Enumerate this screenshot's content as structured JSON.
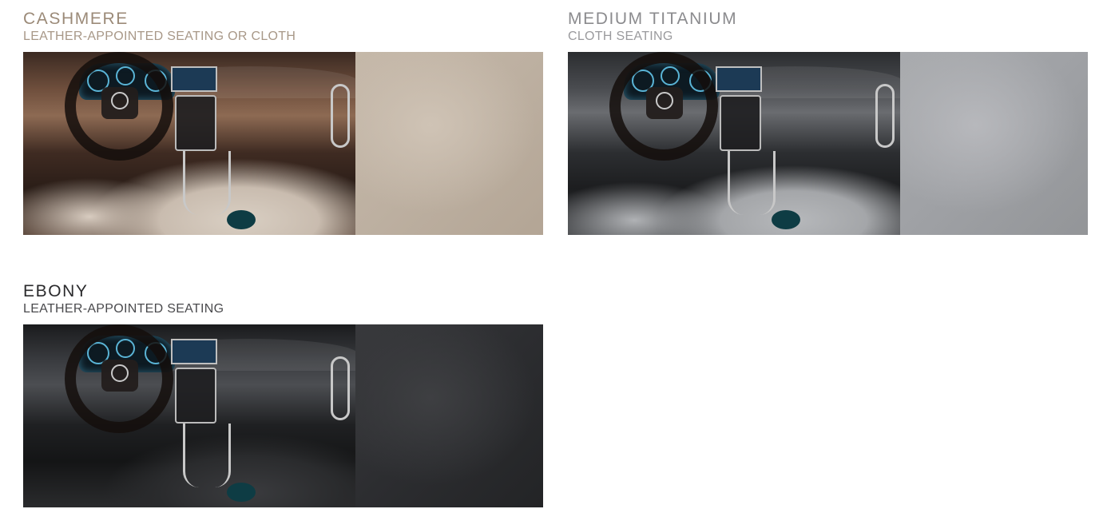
{
  "swatches": [
    {
      "color_name": "CASHMERE",
      "seating": "LEATHER-APPOINTED SEATING OR CLOTH"
    },
    {
      "color_name": "MEDIUM TITANIUM",
      "seating": "CLOTH SEATING"
    },
    {
      "color_name": "EBONY",
      "seating": "LEATHER-APPOINTED SEATING"
    }
  ],
  "colors": {
    "cashmere_texture": "#bfb2a3",
    "titanium_texture": "#a0a2a6",
    "ebony_texture": "#2e2f32"
  }
}
